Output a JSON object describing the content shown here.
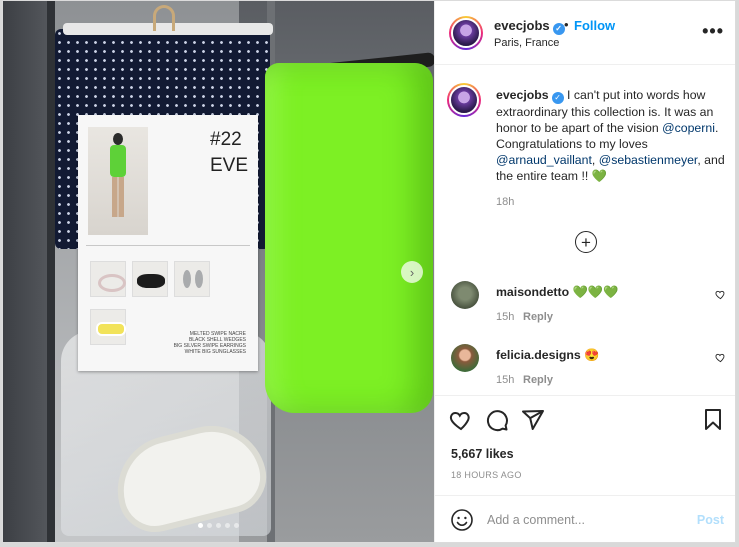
{
  "post": {
    "username": "evecjobs",
    "follow_label": "Follow",
    "separator": "•",
    "location": "Paris, France",
    "more_label": "•••"
  },
  "photo": {
    "card_number": "#22",
    "card_name": "EVE",
    "card_notes": [
      "MELTED SWIPE NACRE",
      "BLACK SHELL WEDGES",
      "BIG SILVER SWIPE EARRINGS",
      "WHITE BIG SUNGLASSES"
    ],
    "carousel_next": "›",
    "slide_count": 5,
    "active_slide": 1
  },
  "caption": {
    "username": "evecjobs",
    "text_1": " I can't put into words how extraordinary this collection is. It was an honor to be apart of the vision ",
    "mention_1": "@coperni",
    "text_2": ". Congratulations to my loves ",
    "mention_2": "@arnaud_vaillant",
    "text_3": ", ",
    "mention_3": "@sebastienmeyer",
    "text_4": ", and the entire team !! 💚",
    "time": "18h"
  },
  "load_more_label": "+",
  "comments": [
    {
      "username": "maisondetto",
      "text": " 💚💚💚",
      "time": "15h",
      "reply": "Reply"
    },
    {
      "username": "felicia.designs",
      "text": " 😍",
      "time": "15h",
      "reply": "Reply"
    }
  ],
  "actions": {
    "likes": "5,667 likes",
    "timestamp": "18 HOURS AGO"
  },
  "composer": {
    "placeholder": "Add a comment...",
    "post_label": "Post"
  },
  "colors": {
    "link_blue": "#0095f6",
    "mention": "#00376b",
    "muted": "#8e8e8e",
    "post_disabled": "#b2dffc",
    "verified": "#3897f0"
  },
  "icons": [
    "verified-icon",
    "more-icon",
    "carousel-next-icon",
    "load-more-icon",
    "heart-icon",
    "comment-icon",
    "share-icon",
    "bookmark-icon",
    "emoji-icon"
  ]
}
